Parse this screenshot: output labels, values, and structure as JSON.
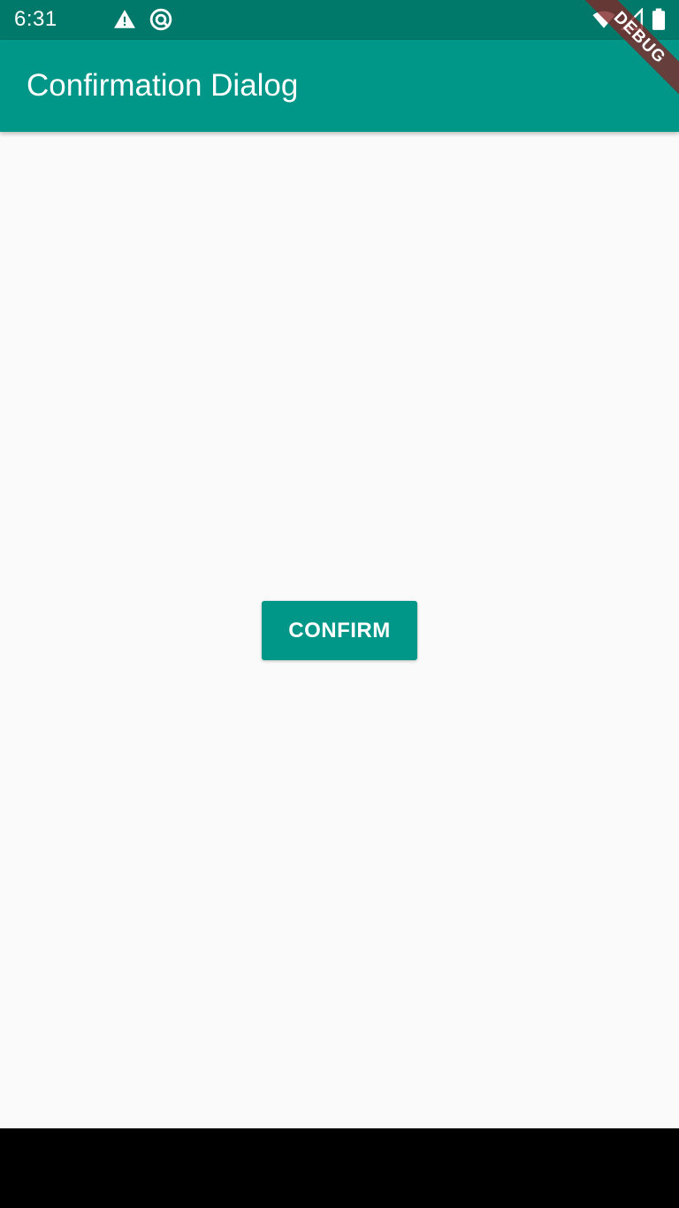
{
  "status_bar": {
    "time": "6:31",
    "icons": [
      "warning-icon",
      "at-sign-icon",
      "wifi-icon",
      "signal-icon",
      "battery-icon"
    ]
  },
  "app_bar": {
    "title": "Confirmation Dialog",
    "color": "#009688"
  },
  "main": {
    "confirm_label": "CONFIRM"
  },
  "debug_banner": {
    "label": "DEBUG",
    "color": "#802828"
  },
  "colors": {
    "status_bar": "#00796b",
    "accent": "#009688",
    "background": "#fafafa",
    "nav_bar": "#000000"
  }
}
